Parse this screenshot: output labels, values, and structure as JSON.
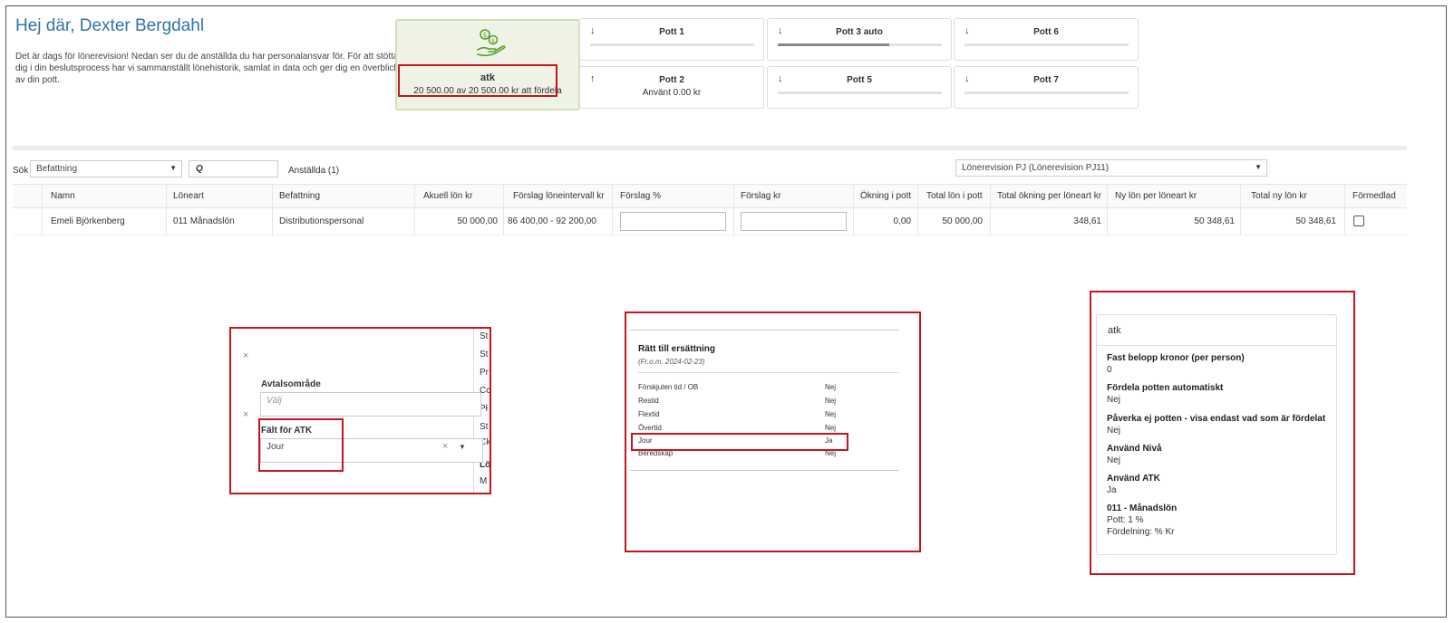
{
  "header": {
    "greeting": "Hej där, Dexter Bergdahl",
    "intro_text": "Det är dags för lönerevision! Nedan ser du de anställda du har personalansvar för. För att stötta dig i din beslutsprocess har vi sammanställt lönehistorik, samlat in data och ger dig en överblick av din pott."
  },
  "atk_card": {
    "icon": "money-hand-icon",
    "label": "atk",
    "amount_text": "20 500.00 av 20 500.00 kr att fördela"
  },
  "pots": [
    {
      "name": "Pott 1",
      "arrow": "↓",
      "progress": 0
    },
    {
      "name": "Pott 3 auto",
      "arrow": "↓",
      "progress": 0.68
    },
    {
      "name": "Pott 6",
      "arrow": "↓",
      "progress": 0
    },
    {
      "name": "Pott 2",
      "arrow": "↑",
      "used_text": "Använt 0.00 kr"
    },
    {
      "name": "Pott 5",
      "arrow": "↓",
      "progress": 0
    },
    {
      "name": "Pott 7",
      "arrow": "↓",
      "progress": 0
    }
  ],
  "filters": {
    "search_label": "Sök",
    "search_field_select": "Befattning",
    "search_icon_text": "Q",
    "employees_count": "Anställda (1)",
    "revision_select": "Lönerevision PJ (Lönerevision PJ11)"
  },
  "table": {
    "headers": [
      "Namn",
      "Löneart",
      "Befattning",
      "Akuell lön kr",
      "Förslag löneintervall kr",
      "Förslag %",
      "Förslag kr",
      "Ökning i pott",
      "Total lön i pott",
      "Total ökning per löneart kr",
      "Ny lön per löneart kr",
      "Total ny lön kr",
      "Förmedlad"
    ],
    "rows": [
      {
        "namn": "Emeli Björkenberg",
        "loneart": "011 Månadslön",
        "befattning": "Distributionspersonal",
        "aktuell_lon": "50 000,00",
        "intervall": "86 400,00 - 92 200,00",
        "okning_pott": "0,00",
        "total_lon_pott": "50 000,00",
        "total_okning": "348,61",
        "ny_lon": "50 348,61",
        "total_ny_lon": "50 348,61"
      }
    ]
  },
  "settings_box": {
    "strip_letters": [
      "St",
      "St",
      "Pr",
      "Cc",
      "Pł",
      "St",
      "Ck",
      "Lör",
      "M"
    ],
    "avtalsomrade_label": "Avtalsområde",
    "avtalsomrade_placeholder": "Välj",
    "falt_label": "Fält för ATK",
    "falt_value": "Jour",
    "clear_symbol": "×"
  },
  "compensation": {
    "title": "Rätt till ersättning",
    "date": "(Fr.o.m. 2024-02-23)",
    "rows": [
      {
        "k": "Förskjuten tid / OB",
        "v": "Nej"
      },
      {
        "k": "Restid",
        "v": "Nej"
      },
      {
        "k": "Flextid",
        "v": "Nej"
      },
      {
        "k": "Övertid",
        "v": "Nej"
      },
      {
        "k": "Jour",
        "v": "Ja"
      },
      {
        "k": "Beredskap",
        "v": "Nej"
      }
    ]
  },
  "atk_details": {
    "title": "atk",
    "items": [
      {
        "k": "Fast belopp kronor (per person)",
        "v": "0"
      },
      {
        "k": "Fördela potten automatiskt",
        "v": "Nej"
      },
      {
        "k": "Påverka ej potten - visa endast vad som är fördelat",
        "v": "Nej"
      },
      {
        "k": "Använd Nivå",
        "v": "Nej"
      },
      {
        "k": "Använd ATK",
        "v": "Ja"
      }
    ],
    "loneart_title": "011 - Månadslön",
    "pott_line": "Pott: 1 %",
    "fordelning_line": "Fördelning: % Kr"
  }
}
